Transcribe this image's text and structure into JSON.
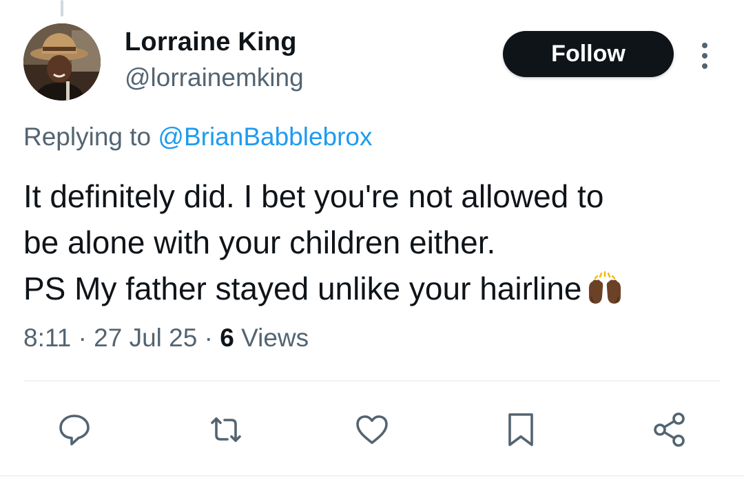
{
  "author": {
    "display_name": "Lorraine King",
    "handle": "@lorrainemking"
  },
  "follow_label": "Follow",
  "reply": {
    "prefix": "Replying to",
    "mention": "@BrianBabblebrox"
  },
  "tweet": {
    "lines": [
      "It definitely did. I bet you're not allowed to",
      "be alone with your children either.",
      "PS My father stayed unlike your hairline"
    ]
  },
  "meta": {
    "time": "8:11",
    "separator": "·",
    "date": "27 Jul 25",
    "views_count": "6",
    "views_label": "Views"
  },
  "icons": {
    "more": "more-vertical-icon",
    "emoji": "raising-hands-emoji",
    "actions": [
      "reply-icon",
      "retweet-icon",
      "like-icon",
      "bookmark-icon",
      "share-icon"
    ]
  },
  "colors": {
    "text": "#0f1419",
    "secondary": "#536471",
    "link": "#1d9bf0",
    "button_bg": "#0f1419",
    "divider": "#eff3f4"
  }
}
